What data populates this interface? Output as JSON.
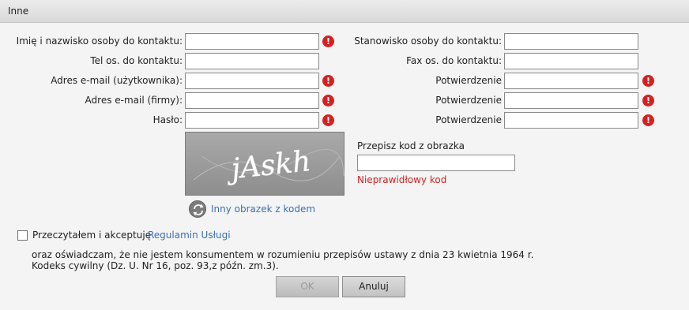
{
  "dialog": {
    "title": "Inne"
  },
  "left_fields": [
    {
      "label": "Imię i nazwisko osoby do kontaktu:",
      "value": "",
      "required": true
    },
    {
      "label": "Tel os. do kontaktu:",
      "value": "",
      "required": false
    },
    {
      "label": "Adres e-mail (użytkownika):",
      "value": "",
      "required": true
    },
    {
      "label": "Adres e-mail (firmy):",
      "value": "",
      "required": true
    },
    {
      "label": "Hasło:",
      "value": "",
      "required": true
    }
  ],
  "right_fields": [
    {
      "label": "Stanowisko osoby do kontaktu:",
      "value": "",
      "required": false
    },
    {
      "label": "Fax os. do kontaktu:",
      "value": "",
      "required": false
    },
    {
      "label": "Potwierdzenie",
      "value": "",
      "required": true
    },
    {
      "label": "Potwierdzenie",
      "value": "",
      "required": true
    },
    {
      "label": "Potwierdzenie",
      "value": "",
      "required": true
    }
  ],
  "warning_glyph": "!",
  "captcha": {
    "image_text": "jAskh",
    "prompt": "Przepisz kod z obrazka",
    "input_value": "",
    "error": "Nieprawidłowy kod",
    "refresh_label": "Inny obrazek z kodem"
  },
  "terms": {
    "checked": false,
    "text": "Przeczytałem i akceptuję",
    "link": "Regulamin Usługi",
    "declaration_line1": "oraz oświadczam, że nie jestem konsumentem w rozumieniu przepisów ustawy z dnia 23 kwietnia 1964 r.",
    "declaration_line2": "Kodeks cywilny (Dz. U. Nr 16, poz. 93,z późn. zm.3)."
  },
  "buttons": {
    "ok": "OK",
    "cancel": "Anuluj"
  },
  "colors": {
    "warning": "#d62020",
    "link": "#3a6fb4",
    "error_text": "#d62020"
  }
}
